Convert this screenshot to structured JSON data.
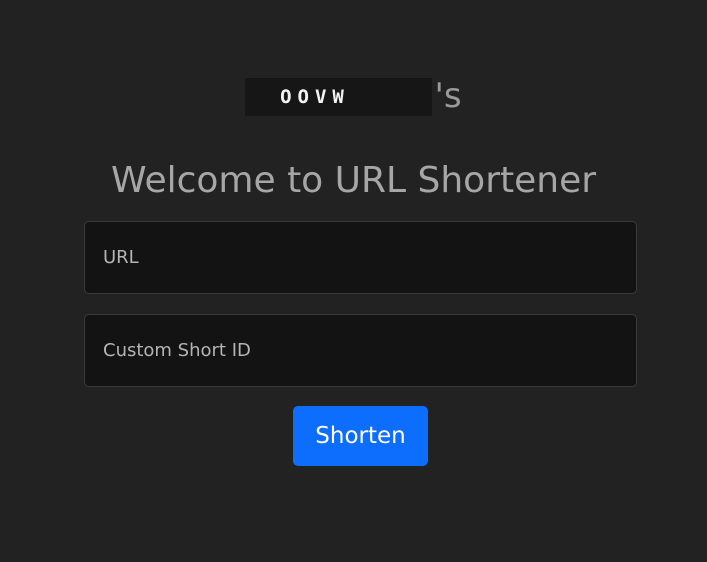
{
  "brand": {
    "logo_text": "OOVW",
    "possessive": "'s"
  },
  "heading": "Welcome to URL Shortener",
  "form": {
    "url_field": {
      "placeholder": "URL",
      "value": ""
    },
    "custom_id_field": {
      "placeholder": "Custom Short ID",
      "value": ""
    },
    "submit_label": "Shorten"
  },
  "colors": {
    "background": "#222222",
    "input_background": "#131313",
    "accent": "#0d6efd",
    "heading_text": "#a6a6a6"
  }
}
